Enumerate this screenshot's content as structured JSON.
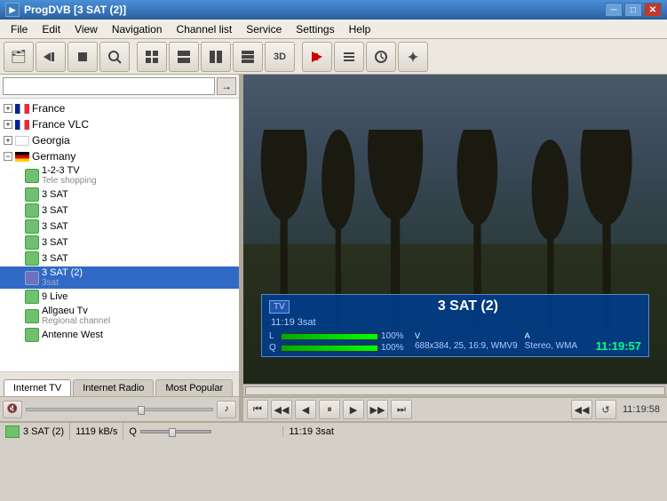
{
  "window": {
    "title": "ProgDVB [3 SAT (2)]",
    "icon": "▶"
  },
  "menu": {
    "items": [
      "File",
      "Edit",
      "View",
      "Navigation",
      "Channel list",
      "Service",
      "Settings",
      "Help"
    ]
  },
  "toolbar": {
    "buttons": [
      {
        "icon": "🗂",
        "name": "open-icon"
      },
      {
        "icon": "◀◀",
        "name": "prev-icon"
      },
      {
        "icon": "⏹",
        "name": "stop-icon"
      },
      {
        "icon": "🔍",
        "name": "search-icon"
      },
      {
        "icon": "⊞",
        "name": "layout1-icon"
      },
      {
        "icon": "⊡",
        "name": "layout2-icon"
      },
      {
        "icon": "▦",
        "name": "layout3-icon"
      },
      {
        "icon": "▤",
        "name": "layout4-icon"
      },
      {
        "icon": "3D",
        "name": "3d-icon"
      },
      {
        "icon": "⬇",
        "name": "download-icon"
      },
      {
        "icon": "≡",
        "name": "list-icon"
      },
      {
        "icon": "⏱",
        "name": "timer-icon"
      },
      {
        "icon": "⚙",
        "name": "settings-icon"
      }
    ]
  },
  "search": {
    "placeholder": "",
    "go_label": "→"
  },
  "channel_tree": {
    "countries": [
      {
        "name": "France",
        "expanded": false,
        "flag": "france"
      },
      {
        "name": "France VLC",
        "expanded": false,
        "flag": "france"
      },
      {
        "name": "Georgia",
        "expanded": false,
        "flag": "georgia"
      },
      {
        "name": "Germany",
        "expanded": true,
        "flag": "germany"
      }
    ],
    "germany_channels": [
      {
        "name": "1-2-3 TV",
        "sub": "Tele shopping",
        "type": "tv",
        "selected": false
      },
      {
        "name": "3 SAT",
        "sub": "",
        "type": "tv",
        "selected": false
      },
      {
        "name": "3 SAT",
        "sub": "",
        "type": "tv",
        "selected": false
      },
      {
        "name": "3 SAT",
        "sub": "",
        "type": "tv",
        "selected": false
      },
      {
        "name": "3 SAT",
        "sub": "",
        "type": "tv",
        "selected": false
      },
      {
        "name": "3 SAT",
        "sub": "",
        "type": "tv",
        "selected": false
      },
      {
        "name": "3 SAT (2)",
        "sub": "3sat",
        "type": "blue",
        "selected": true
      },
      {
        "name": "9 Live",
        "sub": "",
        "type": "tv",
        "selected": false
      },
      {
        "name": "Allgaeu Tv",
        "sub": "Regional channel",
        "type": "tv",
        "selected": false
      },
      {
        "name": "Antenne West",
        "sub": "",
        "type": "tv",
        "selected": false
      }
    ]
  },
  "tabs": {
    "items": [
      "Internet TV",
      "Internet Radio",
      "Most Popular"
    ],
    "active": 0
  },
  "osd": {
    "badge": "TV",
    "channel_name": "3 SAT (2)",
    "time_line": "11:19  3sat",
    "level_label": "L",
    "quality_label": "Q",
    "level_pct": "100%",
    "quality_pct": "100%",
    "level_val": 100,
    "quality_val": 100,
    "tech_v_label": "V",
    "tech_a_label": "A",
    "tech_v_value": "688x384, 25, 16:9, WMV9",
    "tech_a_value": "Stereo, WMA",
    "clock": "11:19:57"
  },
  "playback": {
    "buttons": [
      "⏮",
      "◀◀",
      "◀",
      "⏸",
      "▶",
      "▶▶",
      "⏭"
    ],
    "right_buttons": [
      "◀◀",
      "↺"
    ],
    "time_display": "11:19:58"
  },
  "status": {
    "channel_icon_color": "#70c070",
    "channel_name": "3 SAT (2)",
    "bitrate": "1119 kB/s",
    "q_label": "Q",
    "epg_text": "11:19  3sat"
  }
}
